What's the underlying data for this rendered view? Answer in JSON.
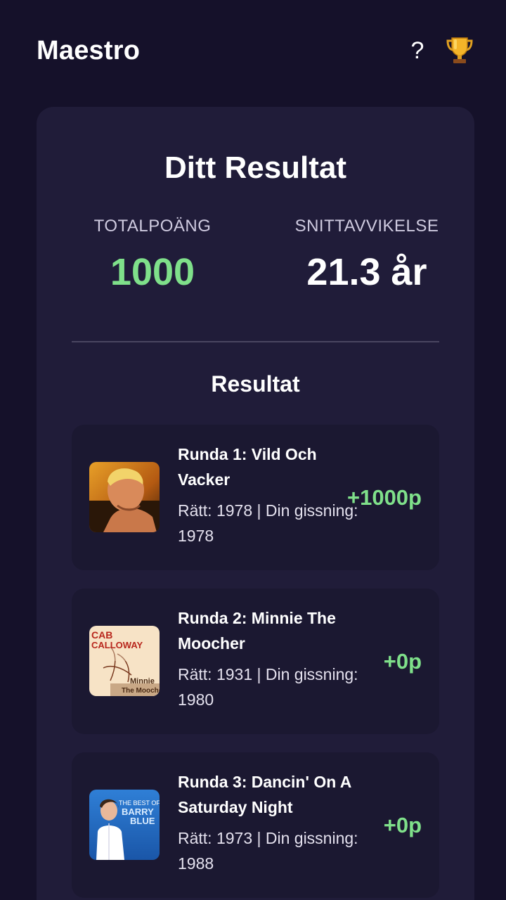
{
  "header": {
    "app_title": "Maestro",
    "help_label": "?",
    "trophy_icon": "trophy-icon"
  },
  "result": {
    "title": "Ditt Resultat",
    "total_label": "TOTALPOÄNG",
    "total_value": "1000",
    "deviation_label": "SNITTAVVIKELSE",
    "deviation_value": "21.3 år"
  },
  "rounds_section": {
    "title": "Resultat",
    "rounds": [
      {
        "name": "Runda 1: Vild Och Vacker",
        "detail": "Rätt: 1978 | Din gissning: 1978",
        "points": "+1000p"
      },
      {
        "name": "Runda 2: Minnie The Moocher",
        "detail": "Rätt: 1931 | Din gissning: 1980",
        "points": "+0p",
        "cover_text": [
          "CAB",
          "CALLOWAY",
          "Minnie",
          "The Moocher"
        ]
      },
      {
        "name": "Runda 3: Dancin' On A Saturday Night",
        "detail": "Rätt: 1973 | Din gissning: 1988",
        "points": "+0p",
        "cover_text": [
          "THE BEST OF",
          "BARRY",
          "BLUE"
        ]
      }
    ]
  },
  "colors": {
    "background": "#15112a",
    "card": "#201c39",
    "round_card": "#1b1831",
    "accent_green": "#7fe08a"
  }
}
